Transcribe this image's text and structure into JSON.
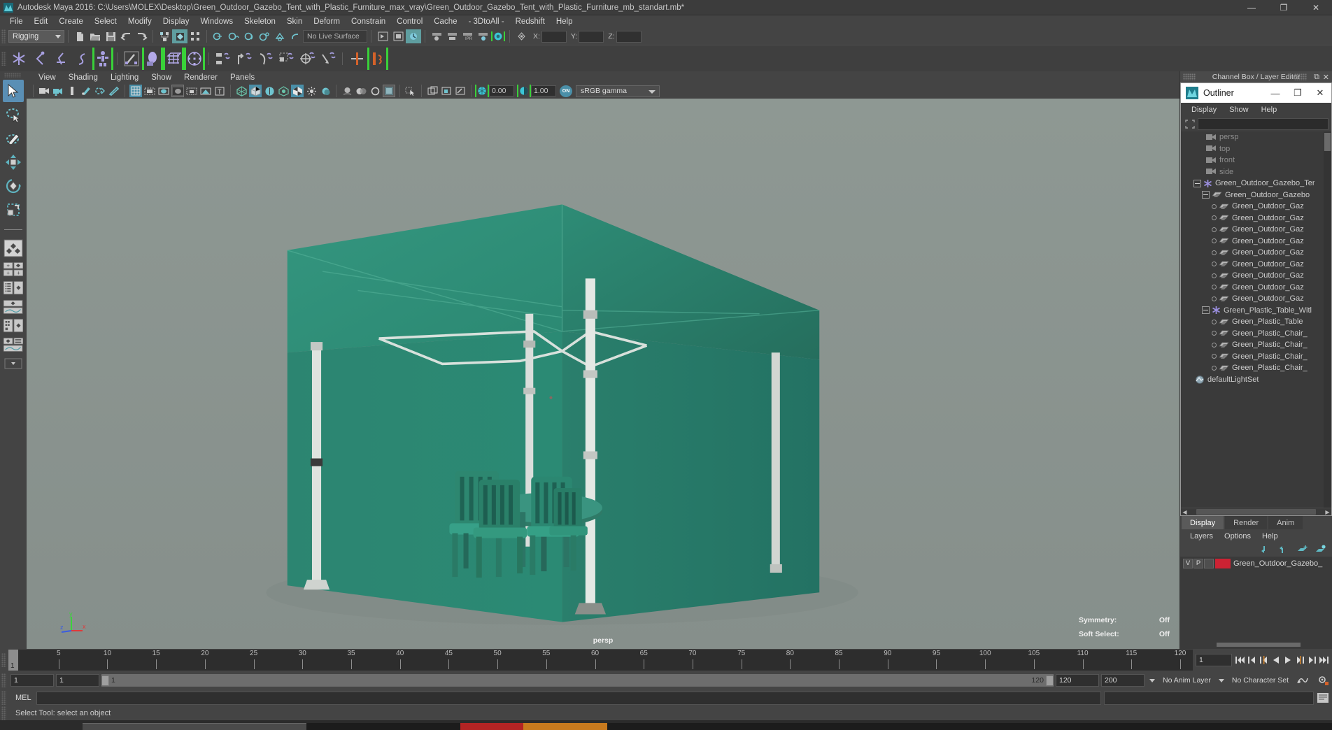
{
  "window": {
    "title": "Autodesk Maya 2016: C:\\Users\\MOLEX\\Desktop\\Green_Outdoor_Gazebo_Tent_with_Plastic_Furniture_max_vray\\Green_Outdoor_Gazebo_Tent_with_Plastic_Furniture_mb_standart.mb*",
    "minimize": "—",
    "maximize": "❐",
    "close": "✕",
    "app_icon": "maya-logo-icon"
  },
  "menubar": {
    "items": [
      {
        "label": "File"
      },
      {
        "label": "Edit"
      },
      {
        "label": "Create"
      },
      {
        "label": "Select"
      },
      {
        "label": "Modify"
      },
      {
        "label": "Display"
      },
      {
        "label": "Windows"
      },
      {
        "label": "Skeleton"
      },
      {
        "label": "Skin"
      },
      {
        "label": "Deform"
      },
      {
        "label": "Constrain"
      },
      {
        "label": "Control"
      },
      {
        "label": "Cache"
      },
      {
        "label": "- 3DtoAll -"
      },
      {
        "label": "Redshift"
      },
      {
        "label": "Help"
      }
    ]
  },
  "statusline": {
    "menuset": "Rigging",
    "live_surface": "No Live Surface",
    "coord_x_label": "X:",
    "coord_y_label": "Y:",
    "coord_z_label": "Z:",
    "coord_x_value": "",
    "coord_y_value": "",
    "coord_z_value": ""
  },
  "viewport_menu": {
    "items": [
      {
        "label": "View"
      },
      {
        "label": "Shading"
      },
      {
        "label": "Lighting"
      },
      {
        "label": "Show"
      },
      {
        "label": "Renderer"
      },
      {
        "label": "Panels"
      }
    ]
  },
  "viewport_tools": {
    "exposure_value": "0.00",
    "gamma_value": "1.00",
    "color_profile": "sRGB gamma",
    "toggle_label": "ON"
  },
  "viewport": {
    "camera_label": "persp",
    "symmetry_label": "Symmetry:",
    "symmetry_value": "Off",
    "soft_select_label": "Soft Select:",
    "soft_select_value": "Off",
    "axis": {
      "x": "x",
      "y": "y",
      "z": "z"
    },
    "bg_top": "#8d9792",
    "bg_bottom": "#8a9490",
    "tent_color": "#2e8a73",
    "tent_color_dark": "#256e5d",
    "pole_color": "#d8dcd8"
  },
  "dock": {
    "header_title": "Channel Box / Layer Editor"
  },
  "outliner": {
    "window_title": "Outliner",
    "menu": [
      {
        "label": "Display"
      },
      {
        "label": "Show"
      },
      {
        "label": "Help"
      }
    ],
    "filter_value": "",
    "items": [
      {
        "label": "persp",
        "icon": "camera-icon",
        "depth": 2,
        "dim": true,
        "node": "leaf"
      },
      {
        "label": "top",
        "icon": "camera-icon",
        "depth": 2,
        "dim": true,
        "node": "leaf"
      },
      {
        "label": "front",
        "icon": "camera-icon",
        "depth": 2,
        "dim": true,
        "node": "leaf"
      },
      {
        "label": "side",
        "icon": "camera-icon",
        "depth": 2,
        "dim": true,
        "node": "leaf"
      },
      {
        "label": "Green_Outdoor_Gazebo_Ter",
        "icon": "star-icon",
        "depth": 0,
        "dim": false,
        "node": "expanded"
      },
      {
        "label": "Green_Outdoor_Gazebo",
        "icon": "mesh-icon",
        "depth": 1,
        "dim": false,
        "node": "expanded"
      },
      {
        "label": "Green_Outdoor_Gaz",
        "icon": "mesh-icon",
        "depth": 2,
        "dim": false,
        "node": "leaf"
      },
      {
        "label": "Green_Outdoor_Gaz",
        "icon": "mesh-icon",
        "depth": 2,
        "dim": false,
        "node": "leaf"
      },
      {
        "label": "Green_Outdoor_Gaz",
        "icon": "mesh-icon",
        "depth": 2,
        "dim": false,
        "node": "leaf"
      },
      {
        "label": "Green_Outdoor_Gaz",
        "icon": "mesh-icon",
        "depth": 2,
        "dim": false,
        "node": "leaf"
      },
      {
        "label": "Green_Outdoor_Gaz",
        "icon": "mesh-icon",
        "depth": 2,
        "dim": false,
        "node": "leaf"
      },
      {
        "label": "Green_Outdoor_Gaz",
        "icon": "mesh-icon",
        "depth": 2,
        "dim": false,
        "node": "leaf"
      },
      {
        "label": "Green_Outdoor_Gaz",
        "icon": "mesh-icon",
        "depth": 2,
        "dim": false,
        "node": "leaf"
      },
      {
        "label": "Green_Outdoor_Gaz",
        "icon": "mesh-icon",
        "depth": 2,
        "dim": false,
        "node": "leaf"
      },
      {
        "label": "Green_Outdoor_Gaz",
        "icon": "mesh-icon",
        "depth": 2,
        "dim": false,
        "node": "leaf"
      },
      {
        "label": "Green_Plastic_Table_Witl",
        "icon": "star-icon",
        "depth": 1,
        "dim": false,
        "node": "expanded"
      },
      {
        "label": "Green_Plastic_Table",
        "icon": "mesh-icon",
        "depth": 2,
        "dim": false,
        "node": "leaf"
      },
      {
        "label": "Green_Plastic_Chair_",
        "icon": "mesh-icon",
        "depth": 2,
        "dim": false,
        "node": "leaf"
      },
      {
        "label": "Green_Plastic_Chair_",
        "icon": "mesh-icon",
        "depth": 2,
        "dim": false,
        "node": "leaf"
      },
      {
        "label": "Green_Plastic_Chair_",
        "icon": "mesh-icon",
        "depth": 2,
        "dim": false,
        "node": "leaf"
      },
      {
        "label": "Green_Plastic_Chair_",
        "icon": "mesh-icon",
        "depth": 2,
        "dim": false,
        "node": "leaf"
      },
      {
        "label": "defaultLightSet",
        "icon": "set-icon",
        "depth": 0,
        "dim": false,
        "node": "leaf"
      }
    ]
  },
  "layer_editor": {
    "tabs": [
      {
        "label": "Display",
        "selected": true
      },
      {
        "label": "Render",
        "selected": false
      },
      {
        "label": "Anim",
        "selected": false
      }
    ],
    "menu": [
      {
        "label": "Layers"
      },
      {
        "label": "Options"
      },
      {
        "label": "Help"
      }
    ],
    "icons": [
      "move-layer-up-icon",
      "move-layer-down-icon",
      "new-layer-icon",
      "new-layer-from-selected-icon"
    ],
    "rows": [
      {
        "visible": "V",
        "playback": "P",
        "type": "",
        "color": "#cc2233",
        "name": "Green_Outdoor_Gazebo_"
      }
    ]
  },
  "timeline": {
    "ticks": [
      1,
      5,
      10,
      15,
      20,
      25,
      30,
      35,
      40,
      45,
      50,
      55,
      60,
      65,
      70,
      75,
      80,
      85,
      90,
      95,
      100,
      105,
      110,
      115,
      120
    ],
    "start": 1,
    "end": 120,
    "current_frame": "1",
    "current_frame_marker": "1",
    "playback_buttons": [
      "go-to-start-icon",
      "step-back-keyframe-icon",
      "step-back-frame-icon",
      "play-backwards-icon",
      "play-forwards-icon",
      "step-forward-frame-icon",
      "step-forward-keyframe-icon",
      "go-to-end-icon"
    ]
  },
  "range_slider": {
    "anim_start": "1",
    "range_start": "1",
    "bar_start_value": "1",
    "bar_end_value": "120",
    "range_end": "120",
    "anim_end": "200",
    "anim_layer": "No Anim Layer",
    "character_set": "No Character Set",
    "anim_pref_icon": "animation-preferences-icon",
    "pref_icon": "preferences-gear-icon"
  },
  "command_line": {
    "language_label": "MEL",
    "input_value": "",
    "output_value": "",
    "script_editor_icon": "script-editor-icon"
  },
  "status_bar": {
    "message": "Select Tool: select an object"
  },
  "toolbox": {
    "items": [
      {
        "name": "select-tool",
        "selected": true
      },
      {
        "name": "lasso-select-tool",
        "selected": false
      },
      {
        "name": "paint-select-tool",
        "selected": false
      },
      {
        "name": "move-tool",
        "selected": false
      },
      {
        "name": "rotate-tool",
        "selected": false
      },
      {
        "name": "scale-tool",
        "selected": false
      },
      {
        "name": "last-tool-used",
        "selected": false
      }
    ],
    "layouts": [
      {
        "name": "single-perspective-view"
      },
      {
        "name": "four-view-layout"
      },
      {
        "name": "persp-outliner-layout"
      },
      {
        "name": "persp-graph-editor-layout"
      },
      {
        "name": "hypershade-persp-layout"
      },
      {
        "name": "persp-graph-outliner-layout"
      }
    ]
  }
}
